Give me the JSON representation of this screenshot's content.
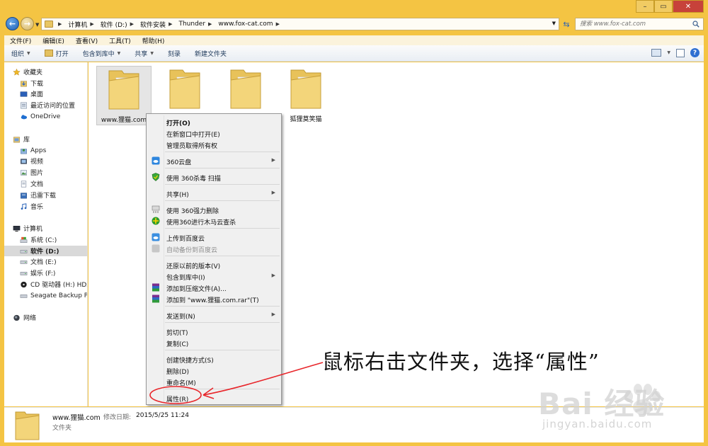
{
  "window": {
    "controls": {
      "minimize": "–",
      "maximize": "▭",
      "close": "✕"
    }
  },
  "address": {
    "crumbs": [
      "计算机",
      "软件 (D:)",
      "软件安装",
      "Thunder",
      "www.fox-cat.com"
    ],
    "search_placeholder": "搜索 www.fox-cat.com"
  },
  "menubar": [
    "文件(F)",
    "编辑(E)",
    "查看(V)",
    "工具(T)",
    "帮助(H)"
  ],
  "toolbar": {
    "organize": "组织",
    "open": "打开",
    "include": "包含到库中",
    "share": "共享",
    "burn": "刻录",
    "new_folder": "新建文件夹",
    "help": "?"
  },
  "navpane": {
    "favorites": "收藏夹",
    "downloads": "下载",
    "desktop": "桌面",
    "recent": "最近访问的位置",
    "onedrive": "OneDrive",
    "libraries": "库",
    "apps": "Apps",
    "videos": "视频",
    "pictures": "图片",
    "documents": "文档",
    "thunder_dl": "迅雷下载",
    "music": "音乐",
    "computer": "计算机",
    "drive_c": "系统 (C:)",
    "drive_d": "软件 (D:)",
    "drive_e": "文档 (E:)",
    "drive_f": "娱乐 (F:)",
    "drive_h": "CD 驱动器 (H:) HDZ",
    "seagate": "Seagate Backup Plus",
    "network": "网络"
  },
  "files": [
    {
      "label": "www.狸猫.com"
    },
    {
      "label": ""
    },
    {
      "label": ""
    },
    {
      "label": "狐狸莫笑猫"
    }
  ],
  "context_menu": {
    "open": "打开(O)",
    "open_new": "在新窗口中打开(E)",
    "admin": "管理员取得所有权",
    "cloud360": "360云盘",
    "scan360": "使用 360杀毒 扫描",
    "share": "共享(H)",
    "force_delete": "使用 360强力删除",
    "trojan": "使用360进行木马云查杀",
    "upload_baidu": "上传到百度云",
    "backup_baidu": "自动备份到百度云",
    "restore": "还原以前的版本(V)",
    "include": "包含到库中(I)",
    "add_archive": "添加到压缩文件(A)...",
    "add_rar": "添加到 \"www.狸猫.com.rar\"(T)",
    "send_to": "发送到(N)",
    "cut": "剪切(T)",
    "copy": "复制(C)",
    "shortcut": "创建快捷方式(S)",
    "delete": "删除(D)",
    "rename": "重命名(M)",
    "properties": "属性(R)"
  },
  "details": {
    "name": "www.狸猫.com",
    "modified_label": "修改日期:",
    "modified_value": "2015/5/25 11:24",
    "type": "文件夹"
  },
  "annotation": {
    "text": "鼠标右击文件夹，选择“属性”",
    "color": "#e8262b"
  },
  "watermark": {
    "brand": "Bai 经验",
    "url": "jingyan.baidu.com"
  }
}
